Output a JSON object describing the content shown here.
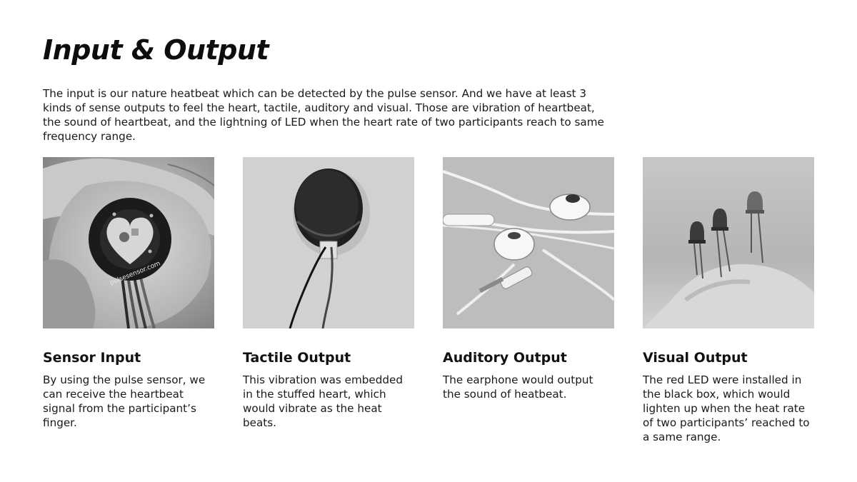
{
  "header": {
    "title": "Input & Output",
    "intro": "The input is our nature heatbeat which can be detected by the pulse sensor. And we have at least 3 kinds of sense outputs to feel the heart, tactile, auditory and visual. Those are vibration of heartbeat, the sound of heartbeat, and the lightning of LED when the heart rate of two participants reach to same frequency range."
  },
  "cards": [
    {
      "title": "Sensor Input",
      "description": "By using the pulse sensor, we can receive the heartbeat signal from the participant’s finger.",
      "photo_label": "pulsesensor.com"
    },
    {
      "title": "Tactile Output",
      "description": "This vibration was embedded in the stuffed heart, which would vibrate as the heat beats."
    },
    {
      "title": "Auditory Output",
      "description": "The earphone would output the sound of heatbeat."
    },
    {
      "title": "Visual Output",
      "description": "The red LED were installed in the black box, which would lighten up when the heat rate of two participants’ reached to a same range."
    }
  ]
}
